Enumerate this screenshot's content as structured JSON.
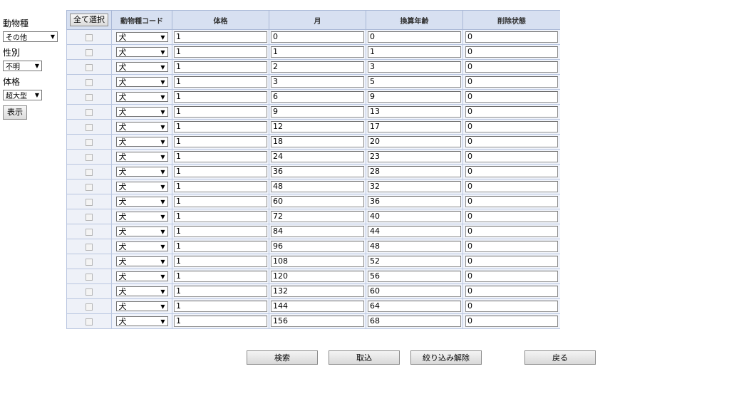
{
  "filter": {
    "animal_label": "動物種",
    "animal_value": "その他",
    "sex_label": "性別",
    "sex_value": "不明",
    "size_label": "体格",
    "size_value": "超大型",
    "show_button": "表示"
  },
  "grid": {
    "select_all": "全て選択",
    "headers": [
      "動物種コード",
      "体格",
      "月",
      "換算年齢",
      "削除状態"
    ],
    "rows": [
      {
        "code": "犬",
        "size": "1",
        "month": "0",
        "age": "0",
        "deleted": "0"
      },
      {
        "code": "犬",
        "size": "1",
        "month": "1",
        "age": "1",
        "deleted": "0"
      },
      {
        "code": "犬",
        "size": "1",
        "month": "2",
        "age": "3",
        "deleted": "0"
      },
      {
        "code": "犬",
        "size": "1",
        "month": "3",
        "age": "5",
        "deleted": "0"
      },
      {
        "code": "犬",
        "size": "1",
        "month": "6",
        "age": "9",
        "deleted": "0"
      },
      {
        "code": "犬",
        "size": "1",
        "month": "9",
        "age": "13",
        "deleted": "0"
      },
      {
        "code": "犬",
        "size": "1",
        "month": "12",
        "age": "17",
        "deleted": "0"
      },
      {
        "code": "犬",
        "size": "1",
        "month": "18",
        "age": "20",
        "deleted": "0"
      },
      {
        "code": "犬",
        "size": "1",
        "month": "24",
        "age": "23",
        "deleted": "0"
      },
      {
        "code": "犬",
        "size": "1",
        "month": "36",
        "age": "28",
        "deleted": "0"
      },
      {
        "code": "犬",
        "size": "1",
        "month": "48",
        "age": "32",
        "deleted": "0"
      },
      {
        "code": "犬",
        "size": "1",
        "month": "60",
        "age": "36",
        "deleted": "0"
      },
      {
        "code": "犬",
        "size": "1",
        "month": "72",
        "age": "40",
        "deleted": "0"
      },
      {
        "code": "犬",
        "size": "1",
        "month": "84",
        "age": "44",
        "deleted": "0"
      },
      {
        "code": "犬",
        "size": "1",
        "month": "96",
        "age": "48",
        "deleted": "0"
      },
      {
        "code": "犬",
        "size": "1",
        "month": "108",
        "age": "52",
        "deleted": "0"
      },
      {
        "code": "犬",
        "size": "1",
        "month": "120",
        "age": "56",
        "deleted": "0"
      },
      {
        "code": "犬",
        "size": "1",
        "month": "132",
        "age": "60",
        "deleted": "0"
      },
      {
        "code": "犬",
        "size": "1",
        "month": "144",
        "age": "64",
        "deleted": "0"
      },
      {
        "code": "犬",
        "size": "1",
        "month": "156",
        "age": "68",
        "deleted": "0"
      }
    ]
  },
  "actions": {
    "search": "検索",
    "import": "取込",
    "clear_filter": "絞り込み解除",
    "back": "戻る"
  },
  "icons": {
    "dropdown": "chevron-down-icon"
  },
  "colors": {
    "header_bg": "#d7e0f1",
    "grid_border": "#b9c6e0"
  }
}
